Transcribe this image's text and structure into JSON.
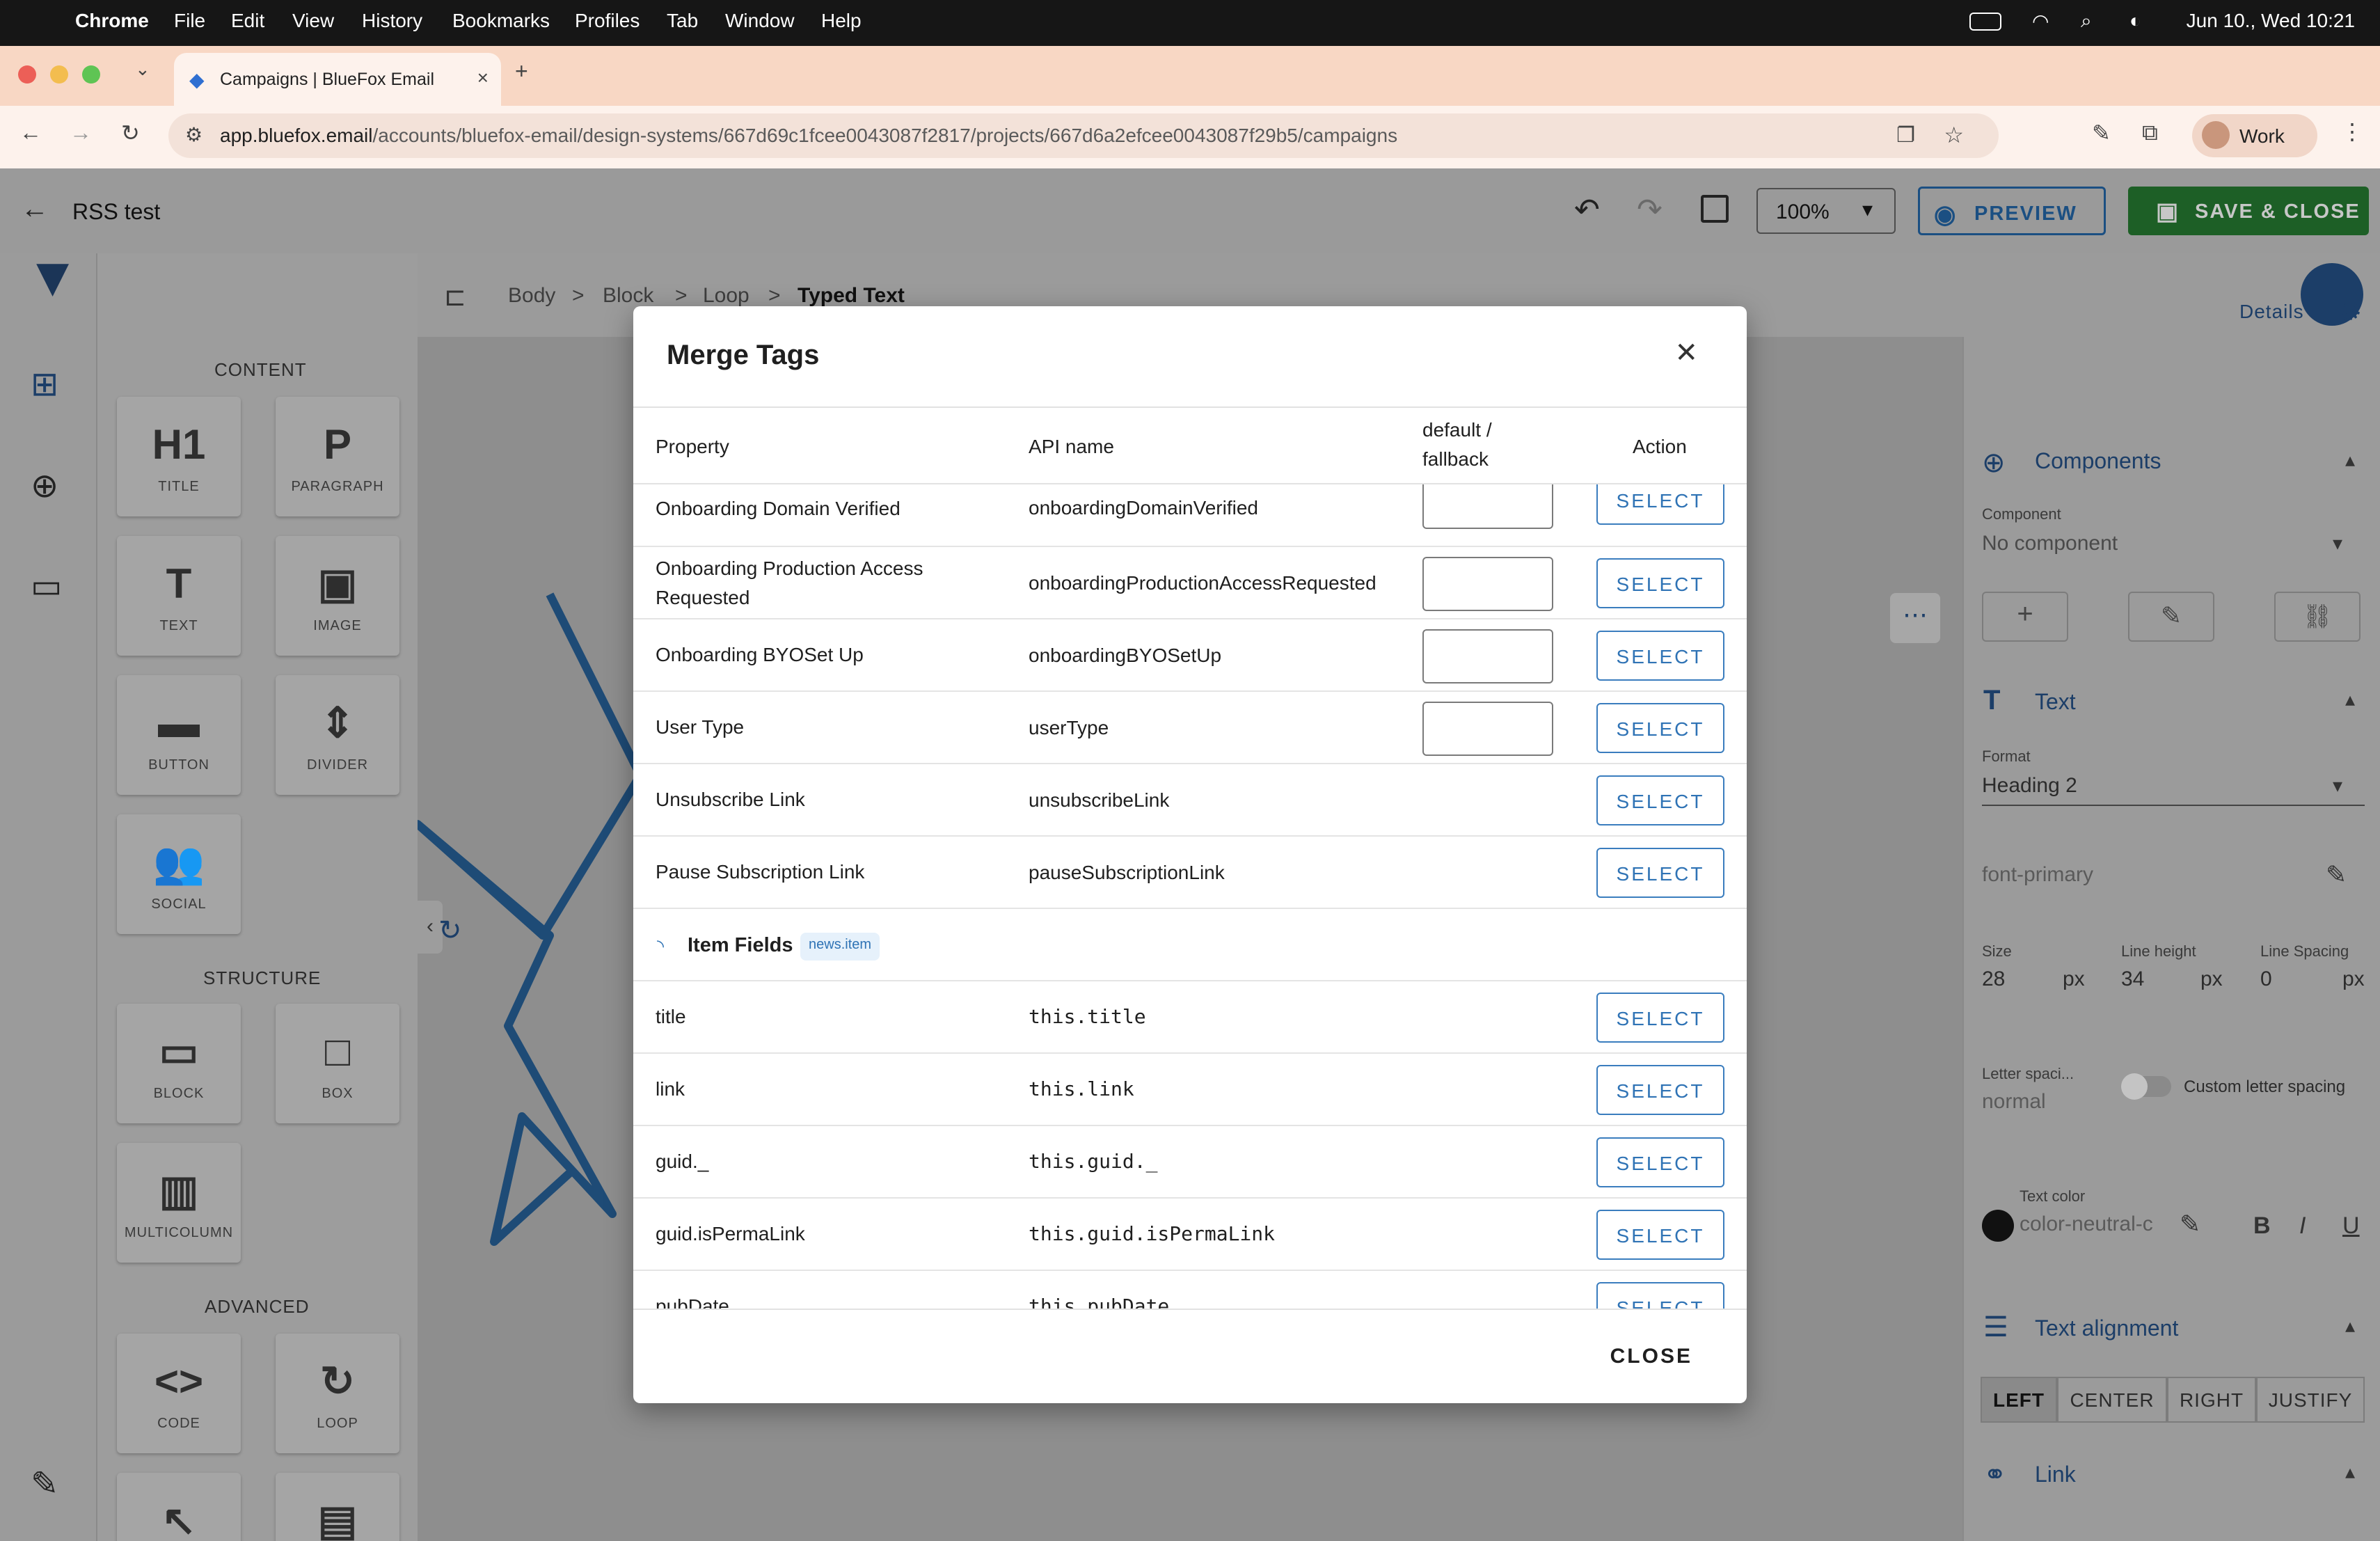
{
  "os_menu": {
    "app": "Chrome",
    "items": [
      "File",
      "Edit",
      "View",
      "History",
      "Bookmarks",
      "Profiles",
      "Tab",
      "Window",
      "Help"
    ],
    "datetime": "Jun 10., Wed 10:21"
  },
  "browser": {
    "tab_title": "Campaigns | BlueFox Email",
    "url_host": "app.bluefox.email",
    "url_path": "/accounts/bluefox-email/design-systems/667d69c1fcee0043087f2817/projects/667d6a2efcee0043087f29b5/campaigns",
    "profile": "Work"
  },
  "app_header": {
    "title": "RSS test",
    "zoom": "100%",
    "preview_label": "PREVIEW",
    "save_label": "SAVE & CLOSE"
  },
  "breadcrumb": [
    "Body",
    ">",
    "Block",
    ">",
    "Loop",
    ">",
    "Typed Text"
  ],
  "palette": {
    "content_title": "CONTENT",
    "content": [
      {
        "icon": "H1",
        "label": "TITLE"
      },
      {
        "icon": "P",
        "label": "PARAGRAPH"
      },
      {
        "icon": "T",
        "label": "TEXT"
      },
      {
        "icon": "▣",
        "label": "IMAGE"
      },
      {
        "icon": "▬",
        "label": "BUTTON"
      },
      {
        "icon": "⇕",
        "label": "DIVIDER"
      },
      {
        "icon": "👥",
        "label": "SOCIAL"
      }
    ],
    "structure_title": "STRUCTURE",
    "structure": [
      {
        "icon": "▭",
        "label": "BLOCK"
      },
      {
        "icon": "□",
        "label": "BOX"
      },
      {
        "icon": "▥",
        "label": "MULTICOLUMN"
      }
    ],
    "advanced_title": "ADVANCED",
    "advanced": [
      {
        "icon": "<>",
        "label": "CODE"
      },
      {
        "icon": "↻",
        "label": "LOOP"
      }
    ]
  },
  "right_panel": {
    "details_label": "Details",
    "components_title": "Components",
    "component_label": "Component",
    "component_value": "No component",
    "text_title": "Text",
    "format_label": "Format",
    "format_value": "Heading 2",
    "font_value": "font-primary",
    "size_label": "Size",
    "size_value": "28",
    "size_unit": "px",
    "line_height_label": "Line height",
    "line_height_value": "34",
    "line_height_unit": "px",
    "line_spacing_label": "Line Spacing",
    "line_spacing_value": "0",
    "line_spacing_unit": "px",
    "letter_spacing_label": "Letter spaci...",
    "letter_spacing_value": "normal",
    "custom_letter_spacing_label": "Custom letter spacing",
    "text_color_label": "Text color",
    "text_color_value": "color-neutral-c",
    "alignment_title": "Text alignment",
    "alignment_options": [
      "LEFT",
      "CENTER",
      "RIGHT",
      "JUSTIFY"
    ],
    "link_title": "Link"
  },
  "modal": {
    "title": "Merge Tags",
    "headers": {
      "property": "Property",
      "api_name": "API name",
      "fallback_line1": "default /",
      "fallback_line2": "fallback",
      "action": "Action"
    },
    "select_label": "SELECT",
    "close_label": "CLOSE",
    "rows": [
      {
        "property": "Onboarding Domain Verified",
        "api": "onboardingDomainVerified"
      },
      {
        "property": "Onboarding Production Access Requested",
        "api": "onboardingProductionAccessRequested"
      },
      {
        "property": "Onboarding BYOSet Up",
        "api": "onboardingBYOSetUp"
      },
      {
        "property": "User Type",
        "api": "userType"
      },
      {
        "property": "Unsubscribe Link",
        "api": "unsubscribeLink"
      },
      {
        "property": "Pause Subscription Link",
        "api": "pauseSubscriptionLink"
      }
    ],
    "group": {
      "label": "Item Fields",
      "chip": "news.item"
    },
    "item_rows": [
      {
        "property": "title",
        "api": "this.title"
      },
      {
        "property": "link",
        "api": "this.link"
      },
      {
        "property": "guid._",
        "api": "this.guid._"
      },
      {
        "property": "guid.isPermaLink",
        "api": "this.guid.isPermaLink"
      },
      {
        "property": "pubDate",
        "api": "this.pubDate"
      }
    ]
  },
  "colors": {
    "accent": "#2f73b5",
    "save_green": "#1d5f26",
    "tab_strip": "#f8d7c4"
  }
}
